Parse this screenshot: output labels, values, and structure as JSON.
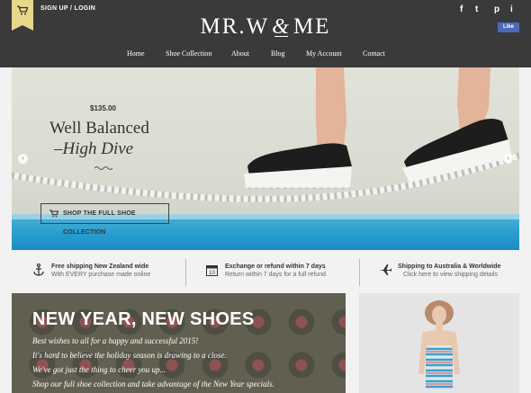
{
  "header": {
    "signup_label": "SIGN UP / LOGIN",
    "logo_left": "MR.W",
    "logo_amp": "&",
    "logo_right": "ME",
    "social": {
      "facebook": "f",
      "twitter": "t",
      "pinterest": "p",
      "instagram": "i"
    },
    "like_label": "Like",
    "nav": [
      "Home",
      "Shoe Collection",
      "About",
      "Blog",
      "My Account",
      "Contact"
    ]
  },
  "hero": {
    "price": "$135.00",
    "title": "Well Balanced",
    "subtitle": "–High Dive",
    "button": "SHOP THE FULL SHOE COLLECTION"
  },
  "features": [
    {
      "icon": "anchor-icon",
      "title": "Free shipping New Zealand wide",
      "sub": "With EVERY purchase made online"
    },
    {
      "icon": "calendar-icon",
      "title": "Exchange or refund within 7 days",
      "sub": "Return within 7 days for a full refund"
    },
    {
      "icon": "airplane-icon",
      "title": "Shipping to Australia & Worldwide",
      "sub": "Click here to view shipping details"
    }
  ],
  "promo": {
    "heading": "NEW YEAR, NEW SHOES",
    "lines": [
      "Best wishes to all for a happy and successful 2015!",
      "It's hard to believe the holiday season is drawing to a close.",
      "We've got just the thing to cheer you up...",
      "Shop our full shoe collection and take advantage of the New Year specials."
    ]
  },
  "colors": {
    "header_bg": "#3a3a3a",
    "accent": "#e8d98a",
    "facebook": "#4c69ba",
    "pool": "#2a9fd0"
  }
}
